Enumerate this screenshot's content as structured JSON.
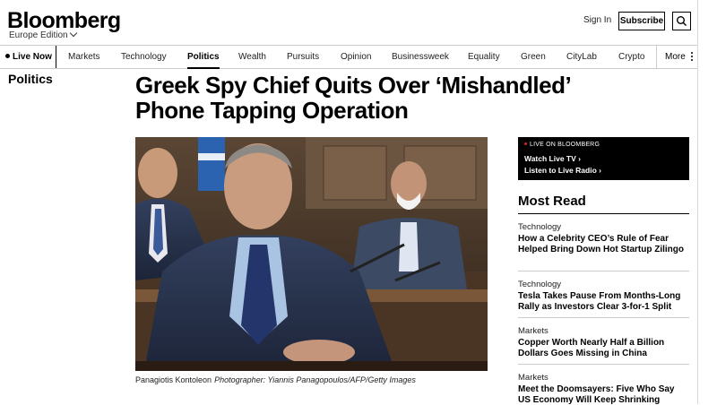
{
  "header": {
    "brand": "Bloomberg",
    "edition": "Europe Edition",
    "sign_in": "Sign In",
    "subscribe": "Subscribe"
  },
  "nav": {
    "live": "Live Now",
    "items": [
      "Markets",
      "Technology",
      "Politics",
      "Wealth",
      "Pursuits",
      "Opinion",
      "Businessweek",
      "Equality",
      "Green",
      "CityLab",
      "Crypto"
    ],
    "active": "Politics",
    "more": "More"
  },
  "article": {
    "section": "Politics",
    "headline": "Greek Spy Chief Quits Over ‘Mishandled’ Phone Tapping Operation",
    "caption": "Panagiotis Kontoleon",
    "credit": "Photographer: Yiannis Panagopoulos/AFP/Getty Images"
  },
  "live_box": {
    "label": "LIVE ON BLOOMBERG",
    "watch": "Watch Live TV",
    "listen": "Listen to Live Radio"
  },
  "most_read": {
    "title": "Most Read",
    "stories": [
      {
        "category": "Technology",
        "title": "How a Celebrity CEO’s Rule of Fear Helped Bring Down Hot Startup Zilingo"
      },
      {
        "category": "Technology",
        "title": "Tesla Takes Pause From Months-Long Rally as Investors Clear 3-for-1 Split"
      },
      {
        "category": "Markets",
        "title": "Copper Worth Nearly Half a Billion Dollars Goes Missing in China"
      },
      {
        "category": "Markets",
        "title": "Meet the Doomsayers: Five Who Say US Economy Will Keep Shrinking"
      }
    ]
  },
  "colors": {
    "live_dot": "#e02020",
    "text": "#000000",
    "live_box_bg": "#000000"
  },
  "icons": {
    "search": "search-icon",
    "more": "kebab-icon",
    "edition": "chevron-down-icon",
    "links": "chevron-right-icon"
  }
}
